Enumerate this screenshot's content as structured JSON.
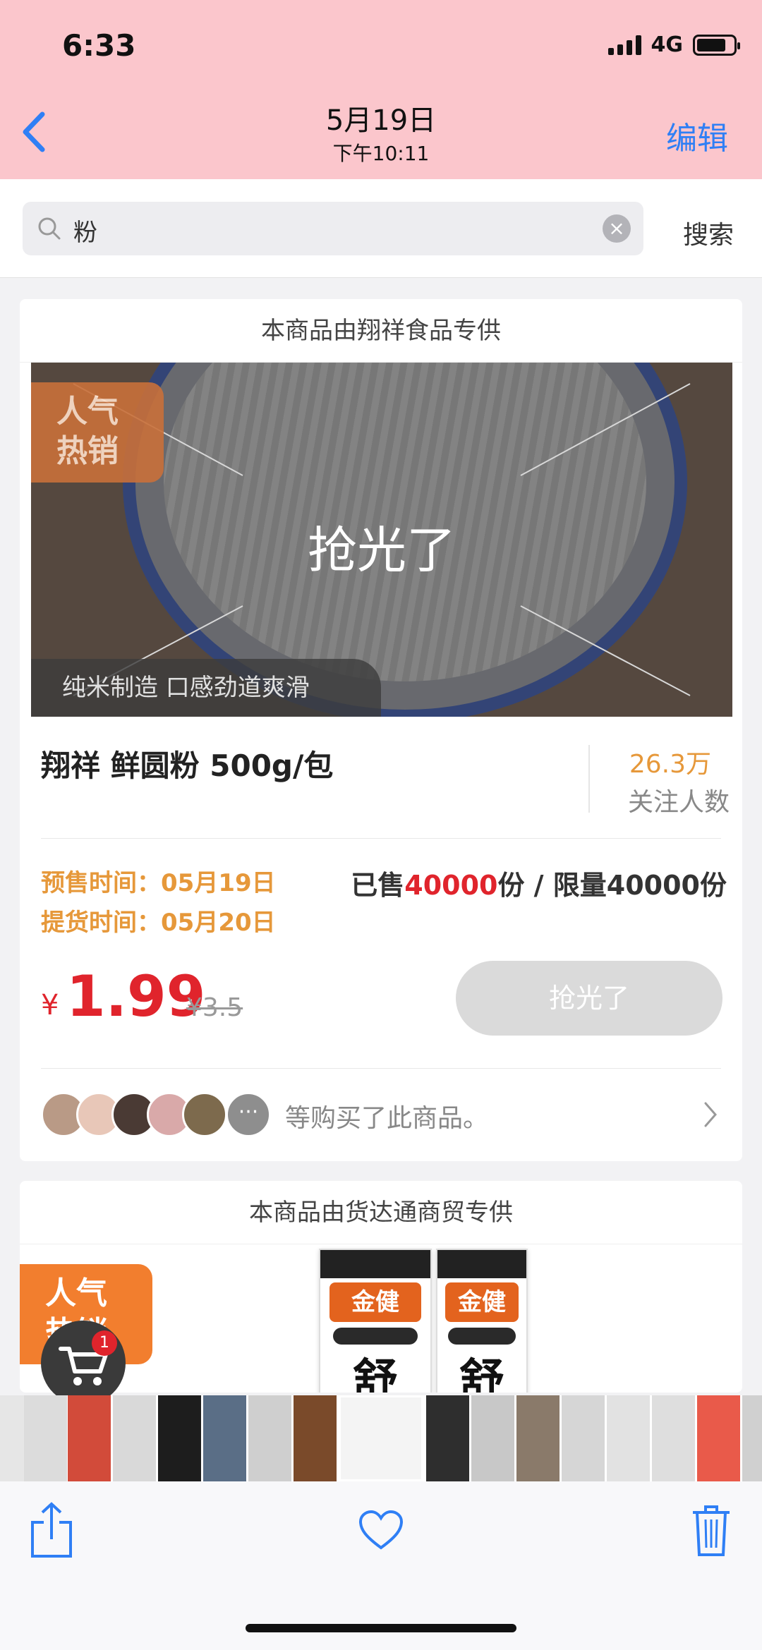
{
  "status": {
    "time": "6:33",
    "network": "4G"
  },
  "nav": {
    "title": "5月19日",
    "subtitle": "下午10:11",
    "edit": "编辑"
  },
  "search": {
    "query": "粉",
    "button": "搜索"
  },
  "product1": {
    "supplier": "本商品由翔祥食品专供",
    "badge": "人气\n热销",
    "overlay": "抢光了",
    "tagline": "纯米制造 口感劲道爽滑",
    "name": "翔祥 鲜圆粉 500g/包",
    "followers": "26.3万",
    "followers_label": "关注人数",
    "presale_label": "预售时间：",
    "presale_date": "05月19日",
    "pickup_label": "提货时间：",
    "pickup_date": "05月20日",
    "sold_prefix": "已售",
    "sold_count": "40000",
    "sold_suffix": "份 / 限量40000份",
    "currency": "¥",
    "price": "1.99",
    "old_price": "¥3.5",
    "button": "抢光了",
    "buyers_more": "···",
    "buyers_text": "等购买了此商品。"
  },
  "product2": {
    "supplier": "本商品由货达通商贸专供",
    "badge": "人气\n热销",
    "bag_brand": "金健",
    "bag_char": "舒"
  },
  "cart": {
    "count": "1"
  },
  "colors": {
    "nav_bg": "#fbc6cc",
    "accent_blue": "#2f7ff5",
    "price_red": "#e0242c",
    "label_orange": "#e6983a",
    "button_disabled": "#dadada"
  },
  "icons": [
    "back-chevron-icon",
    "search-icon",
    "clear-icon",
    "chevron-right-icon",
    "cart-icon",
    "share-icon",
    "heart-icon",
    "trash-icon"
  ]
}
